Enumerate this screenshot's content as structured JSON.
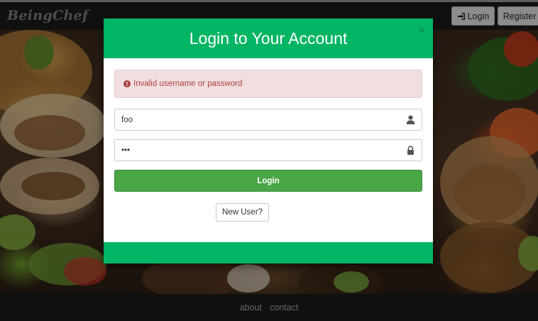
{
  "navbar": {
    "brand": "BeingChef",
    "login_label": "Login",
    "register_label": "Register"
  },
  "footer": {
    "links": [
      "about",
      "contact"
    ]
  },
  "modal": {
    "title": "Login to Your Account",
    "close_glyph": "×",
    "alert_text": "Invalid username or password",
    "username_value": "foo",
    "password_value": "•••",
    "login_button": "Login",
    "new_user_button": "New User?"
  },
  "colors": {
    "accent_green": "#00b564",
    "login_button": "#4aa547",
    "alert_bg": "#f2dede",
    "alert_text": "#a94442"
  },
  "icons": {
    "login": "sign-in-icon",
    "alert": "exclamation-circle-icon",
    "username": "user-icon",
    "password": "lock-icon"
  }
}
